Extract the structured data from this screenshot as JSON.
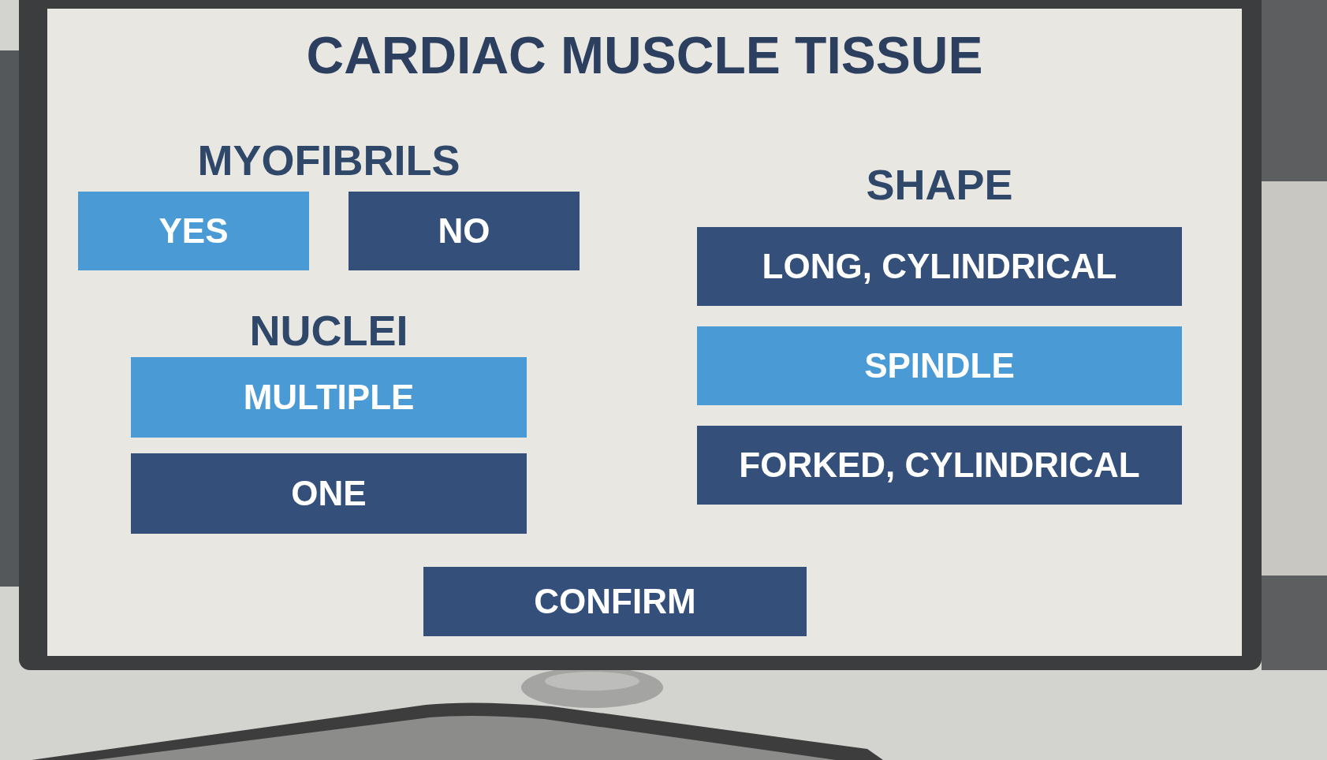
{
  "title": "CARDIAC MUSCLE TISSUE",
  "left_column": {
    "groups": [
      {
        "label": "MYOFIBRILS",
        "kind": "row",
        "options": [
          {
            "label": "YES",
            "selected": true
          },
          {
            "label": "NO",
            "selected": false
          }
        ]
      },
      {
        "label": "NUCLEI",
        "kind": "stack",
        "options": [
          {
            "label": "MULTIPLE",
            "selected": true
          },
          {
            "label": "ONE",
            "selected": false
          }
        ]
      }
    ]
  },
  "right_column": {
    "groups": [
      {
        "label": "SHAPE",
        "kind": "stack",
        "options": [
          {
            "label": "LONG, CYLINDRICAL",
            "selected": false
          },
          {
            "label": "SPINDLE",
            "selected": true
          },
          {
            "label": "FORKED, CYLINDRICAL",
            "selected": false
          }
        ]
      }
    ]
  },
  "confirm_button": {
    "label": "CONFIRM"
  }
}
